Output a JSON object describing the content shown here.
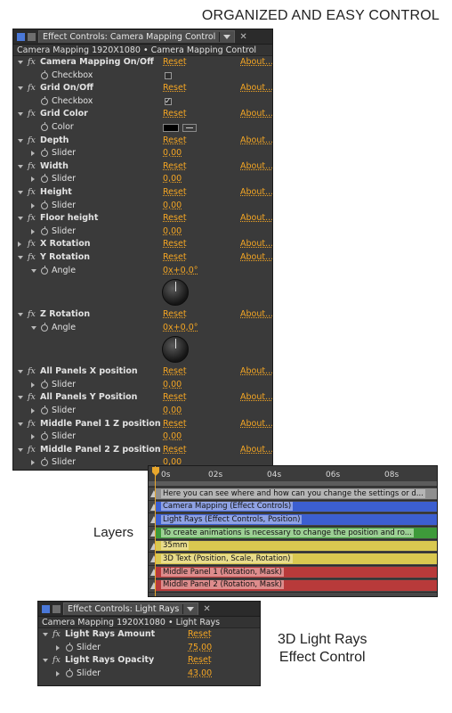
{
  "heading": "ORGANIZED AND EASY CONTROL",
  "labels": {
    "layers": "Layers",
    "light_rays_line1": "3D Light Rays",
    "light_rays_line2": "Effect Control"
  },
  "colors": {
    "accent": "#f5a623",
    "panel_bg": "#3a3a3a"
  },
  "main_panel": {
    "tab_title": "Effect Controls: Camera Mapping Control",
    "layer_header": "Camera Mapping 1920X1080 • Camera Mapping Control",
    "reset_label": "Reset",
    "about_label": "About...",
    "effects": [
      {
        "name": "Camera Mapping On/Off",
        "expanded": true,
        "param": {
          "label": "Checkbox",
          "type": "checkbox",
          "checked": false
        }
      },
      {
        "name": "Grid On/Off",
        "expanded": true,
        "param": {
          "label": "Checkbox",
          "type": "checkbox",
          "checked": true
        }
      },
      {
        "name": "Grid Color",
        "expanded": true,
        "param": {
          "label": "Color",
          "type": "color",
          "color": "#000000"
        }
      },
      {
        "name": "Depth",
        "expanded": true,
        "param": {
          "label": "Slider",
          "type": "slider",
          "value": "0,00"
        }
      },
      {
        "name": "Width",
        "expanded": true,
        "param": {
          "label": "Slider",
          "type": "slider",
          "value": "0,00"
        }
      },
      {
        "name": "Height",
        "expanded": true,
        "param": {
          "label": "Slider",
          "type": "slider",
          "value": "0,00"
        }
      },
      {
        "name": "Floor height",
        "expanded": true,
        "param": {
          "label": "Slider",
          "type": "slider",
          "value": "0,00"
        }
      },
      {
        "name": "X Rotation",
        "expanded": false
      },
      {
        "name": "Y Rotation",
        "expanded": true,
        "param": {
          "label": "Angle",
          "type": "angle",
          "value": "0x+0,0°"
        }
      },
      {
        "name": "Z Rotation",
        "expanded": true,
        "param": {
          "label": "Angle",
          "type": "angle",
          "value": "0x+0,0°"
        }
      },
      {
        "name": "All Panels X position",
        "expanded": true,
        "param": {
          "label": "Slider",
          "type": "slider",
          "value": "0,00"
        }
      },
      {
        "name": "All Panels Y Position",
        "expanded": true,
        "param": {
          "label": "Slider",
          "type": "slider",
          "value": "0,00"
        }
      },
      {
        "name": "Middle Panel 1 Z position",
        "expanded": true,
        "param": {
          "label": "Slider",
          "type": "slider",
          "value": "0,00"
        }
      },
      {
        "name": "Middle Panel 2 Z position",
        "expanded": true,
        "param": {
          "label": "Slider",
          "type": "slider",
          "value": "0,00"
        }
      }
    ]
  },
  "timeline": {
    "ruler": [
      "0s",
      "02s",
      "04s",
      "06s",
      "08s"
    ],
    "layers": [
      {
        "text": "Here you can see where and how can you change the settings or d...",
        "color": "#8f8f8f",
        "label_bg": "#b5b5b5"
      },
      {
        "text": "Camera Mapping (Effect Controls)",
        "color": "#3c5fd0",
        "label_bg": "#8fa2e4"
      },
      {
        "text": "Light Rays (Effect Controls, Position)",
        "color": "#3c5fd0",
        "label_bg": "#8fa2e4"
      },
      {
        "text": "To create animations is necessary to change the position and ro...",
        "color": "#3e9a3a",
        "label_bg": "#9ccf94"
      },
      {
        "text": "35mm",
        "color": "#d9c850",
        "label_bg": "#e8dc8c"
      },
      {
        "text": "3D Text (Position, Scale, Rotation)",
        "color": "#d9c850",
        "label_bg": "#e8dc8c"
      },
      {
        "text": "Middle Panel 1 (Rotation, Mask)",
        "color": "#b83a3a",
        "label_bg": "#dd8c8c"
      },
      {
        "text": "Middle Panel 2 (Rotation, Mask)",
        "color": "#b83a3a",
        "label_bg": "#dd8c8c"
      }
    ]
  },
  "small_panel": {
    "tab_title": "Effect Controls: Light Rays",
    "layer_header": "Camera Mapping 1920X1080 • Light Rays",
    "reset_label": "Reset",
    "effects": [
      {
        "name": "Light Rays Amount",
        "param": {
          "label": "Slider",
          "value": "75,00"
        }
      },
      {
        "name": "Light Rays Opacity",
        "param": {
          "label": "Slider",
          "value": "43,00"
        }
      }
    ]
  }
}
